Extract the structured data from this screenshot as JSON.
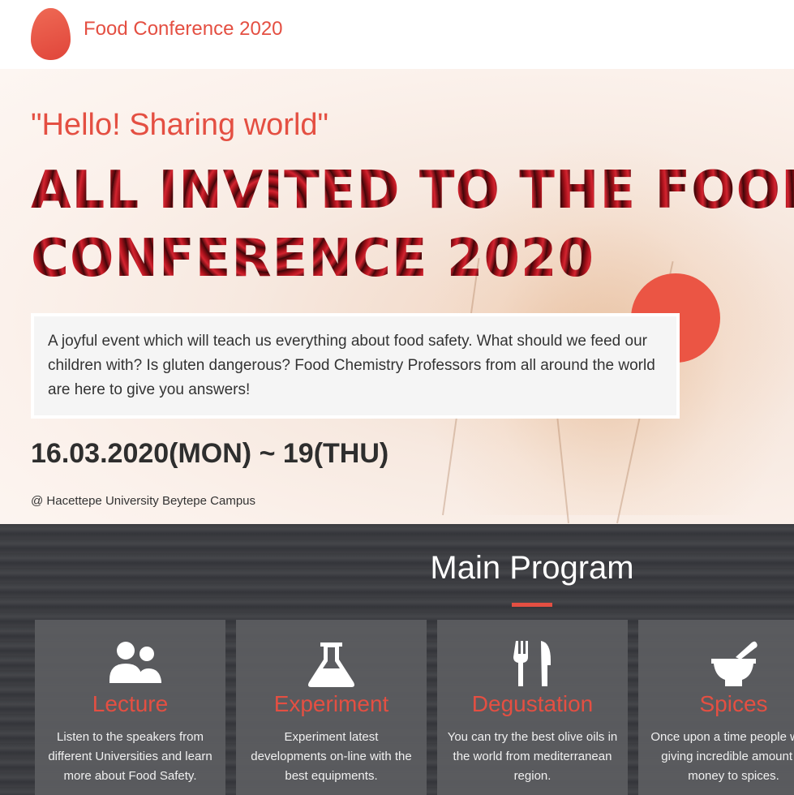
{
  "header": {
    "brand": "Food Conference 2020"
  },
  "hero": {
    "subtitle": "\"Hello! Sharing world\"",
    "headline_line1": "ALL INVITED TO THE FOOD",
    "headline_line2": "CONFERENCE 2020",
    "description": "A joyful event which will teach us everything about food safety. What should we feed our children with? Is gluten dangerous? Food Chemistry Professors from all around the world are here to give you answers!",
    "dates": "16.03.2020(MON) ~ 19(THU)",
    "venue": "@ Hacettepe University Beytepe Campus"
  },
  "program": {
    "title": "Main Program",
    "cards": [
      {
        "icon": "users-icon",
        "title": "Lecture",
        "text": "Listen to the speakers from different Universities and learn more about Food Safety."
      },
      {
        "icon": "flask-icon",
        "title": "Experiment",
        "text": "Experiment latest developments on-line with the best equipments."
      },
      {
        "icon": "utensils-icon",
        "title": "Degustation",
        "text": "You can try the best olive oils in the world from mediterranean region."
      },
      {
        "icon": "mortar-pestle-icon",
        "title": "Spices",
        "text": "Once upon a time people were giving incredible amount of money to spices."
      }
    ]
  },
  "colors": {
    "accent": "#e44f42",
    "dark_bg": "#3c3d41",
    "card_bg": "#5c5d61"
  }
}
